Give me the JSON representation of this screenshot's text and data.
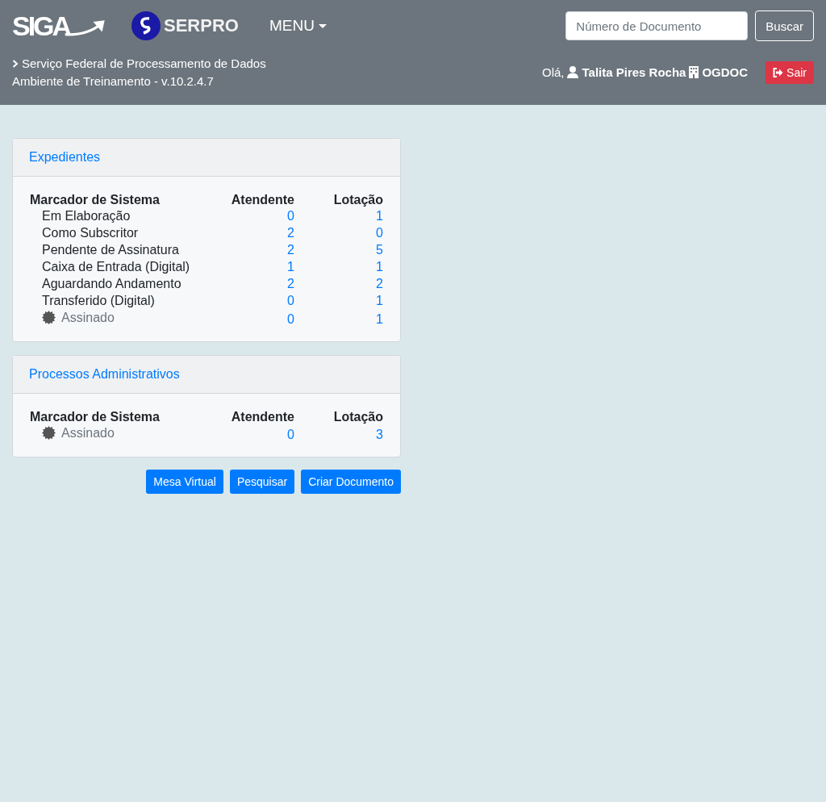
{
  "header": {
    "logo_text": "SIGA",
    "partner_logo_text": "SERPRO",
    "menu": "MENU",
    "search": {
      "placeholder": "Número de Documento"
    },
    "search_button": "Buscar",
    "org_name": "Serviço Federal de Processamento de Dados",
    "environment": "Ambiente de Treinamento - v.10.2.4.7",
    "greeting": "Olá,",
    "user": "Talita Pires Rocha",
    "unit": "OGDOC",
    "logout": "Sair"
  },
  "panels": [
    {
      "title": "Expedientes",
      "columns": [
        "Marcador de Sistema",
        "Atendente",
        "Lotação"
      ],
      "rows": [
        {
          "kind": "plain",
          "label": "Em Elaboração",
          "atendente": "0",
          "lotacao": "1"
        },
        {
          "kind": "plain",
          "label": "Como Subscritor",
          "atendente": "2",
          "lotacao": "0"
        },
        {
          "kind": "plain",
          "label": "Pendente de Assinatura",
          "atendente": "2",
          "lotacao": "5"
        },
        {
          "kind": "plain",
          "label": "Caixa de Entrada (Digital)",
          "atendente": "1",
          "lotacao": "1"
        },
        {
          "kind": "plain",
          "label": "Aguardando Andamento",
          "atendente": "2",
          "lotacao": "2"
        },
        {
          "kind": "plain",
          "label": "Transferido (Digital)",
          "atendente": "0",
          "lotacao": "1"
        },
        {
          "kind": "signed",
          "label": "Assinado",
          "atendente": "0",
          "lotacao": "1"
        }
      ]
    },
    {
      "title": "Processos Administrativos",
      "columns": [
        "Marcador de Sistema",
        "Atendente",
        "Lotação"
      ],
      "rows": [
        {
          "kind": "signed",
          "label": "Assinado",
          "atendente": "0",
          "lotacao": "3"
        }
      ]
    }
  ],
  "actions": [
    "Mesa Virtual",
    "Pesquisar",
    "Criar Documento"
  ]
}
